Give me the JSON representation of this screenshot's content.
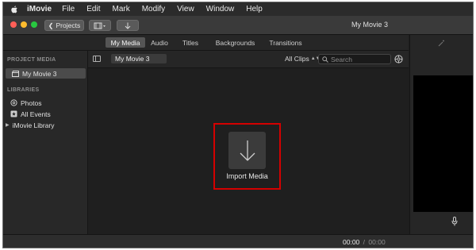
{
  "menubar": {
    "apple_icon": "apple-icon",
    "items": [
      "iMovie",
      "File",
      "Edit",
      "Mark",
      "Modify",
      "View",
      "Window",
      "Help"
    ]
  },
  "toolbar": {
    "projects_label": "Projects",
    "window_title": "My Movie 3"
  },
  "tabs": [
    "My Media",
    "Audio",
    "Titles",
    "Backgrounds",
    "Transitions"
  ],
  "active_tab": "My Media",
  "sidebar": {
    "project_header": "PROJECT MEDIA",
    "project_item": "My Movie 3",
    "libraries_header": "LIBRARIES",
    "library_items": [
      "Photos",
      "All Events",
      "iMovie Library"
    ]
  },
  "browser": {
    "title": "My Movie 3",
    "clips_filter": "All Clips",
    "search_placeholder": "Search",
    "import_label": "Import Media"
  },
  "timecode": {
    "current": "00:00",
    "separator": "/",
    "total": "00:00"
  },
  "colors": {
    "highlight_border": "#d40000",
    "close": "#ff5f57",
    "minimize": "#febc2e",
    "zoom": "#28c840"
  }
}
